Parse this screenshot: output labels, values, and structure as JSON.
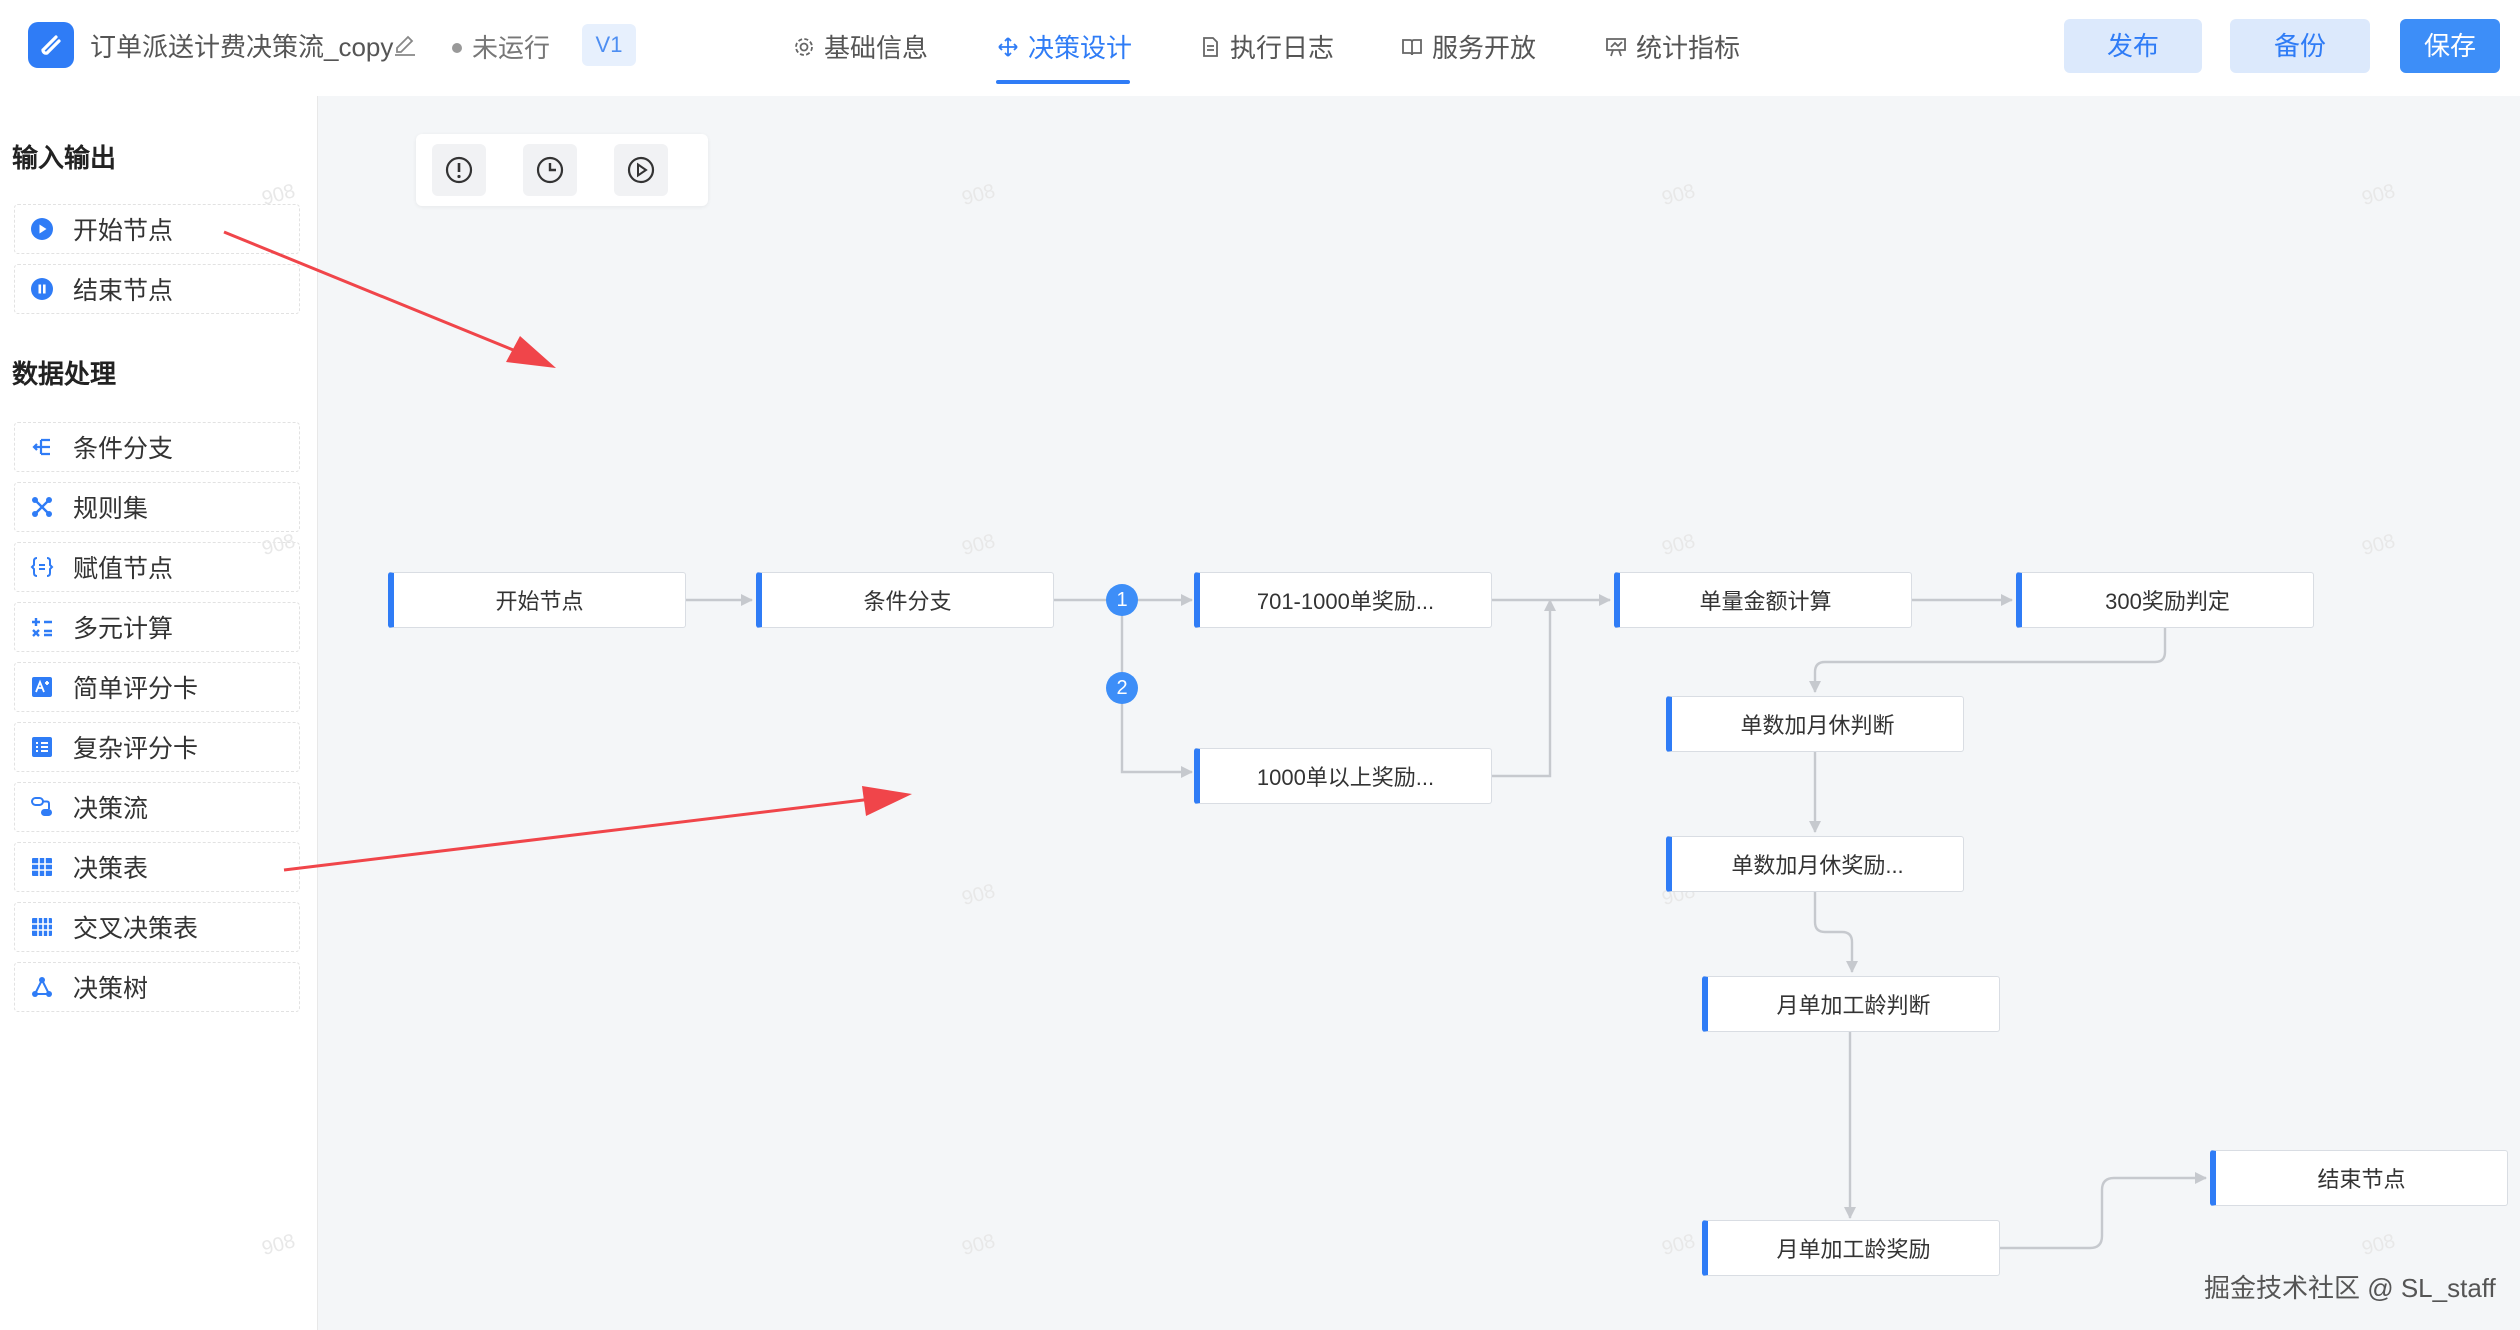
{
  "header": {
    "title": "订单派送计费决策流_copy",
    "status": "未运行",
    "version": "V1",
    "tabs": [
      {
        "label": "基础信息",
        "icon": "gear-icon"
      },
      {
        "label": "决策设计",
        "icon": "move-icon"
      },
      {
        "label": "执行日志",
        "icon": "document-icon"
      },
      {
        "label": "服务开放",
        "icon": "book-icon"
      },
      {
        "label": "统计指标",
        "icon": "chart-icon"
      }
    ],
    "active_tab": "决策设计",
    "buttons": {
      "publish": "发布",
      "backup": "备份",
      "save": "保存"
    }
  },
  "sidebar": {
    "io_title": "输入输出",
    "io_items": [
      {
        "label": "开始节点",
        "icon": "play-circle-icon"
      },
      {
        "label": "结束节点",
        "icon": "pause-circle-icon"
      }
    ],
    "data_title": "数据处理",
    "data_items": [
      {
        "label": "条件分支",
        "icon": "branch-icon"
      },
      {
        "label": "规则集",
        "icon": "ruleset-icon"
      },
      {
        "label": "赋值节点",
        "icon": "assign-icon"
      },
      {
        "label": "多元计算",
        "icon": "calculate-icon"
      },
      {
        "label": "简单评分卡",
        "icon": "scorecard-icon"
      },
      {
        "label": "复杂评分卡",
        "icon": "complex-scorecard-icon"
      },
      {
        "label": "决策流",
        "icon": "flow-icon"
      },
      {
        "label": "决策表",
        "icon": "table-icon"
      },
      {
        "label": "交叉决策表",
        "icon": "cross-table-icon"
      },
      {
        "label": "决策树",
        "icon": "tree-icon"
      }
    ]
  },
  "toolbar": {
    "tools": [
      {
        "icon": "info-circle-icon"
      },
      {
        "icon": "clock-icon"
      },
      {
        "icon": "play-circle-icon"
      }
    ]
  },
  "flow": {
    "nodes": [
      {
        "label": "开始节点"
      },
      {
        "label": "条件分支"
      },
      {
        "label": "701-1000单奖励..."
      },
      {
        "label": "1000单以上奖励..."
      },
      {
        "label": "单量金额计算"
      },
      {
        "label": "300奖励判定"
      },
      {
        "label": "单数加月休判断"
      },
      {
        "label": "单数加月休奖励..."
      },
      {
        "label": "月单加工龄判断"
      },
      {
        "label": "月单加工龄奖励"
      },
      {
        "label": "结束节点"
      }
    ],
    "branch_badges": [
      "1",
      "2"
    ]
  },
  "watermark": "908",
  "credit": "掘金技术社区 @ SL_staff",
  "colors": {
    "accent": "#2f7cf6",
    "arrow": "#f0454a",
    "edge": "#c6c9ce"
  }
}
